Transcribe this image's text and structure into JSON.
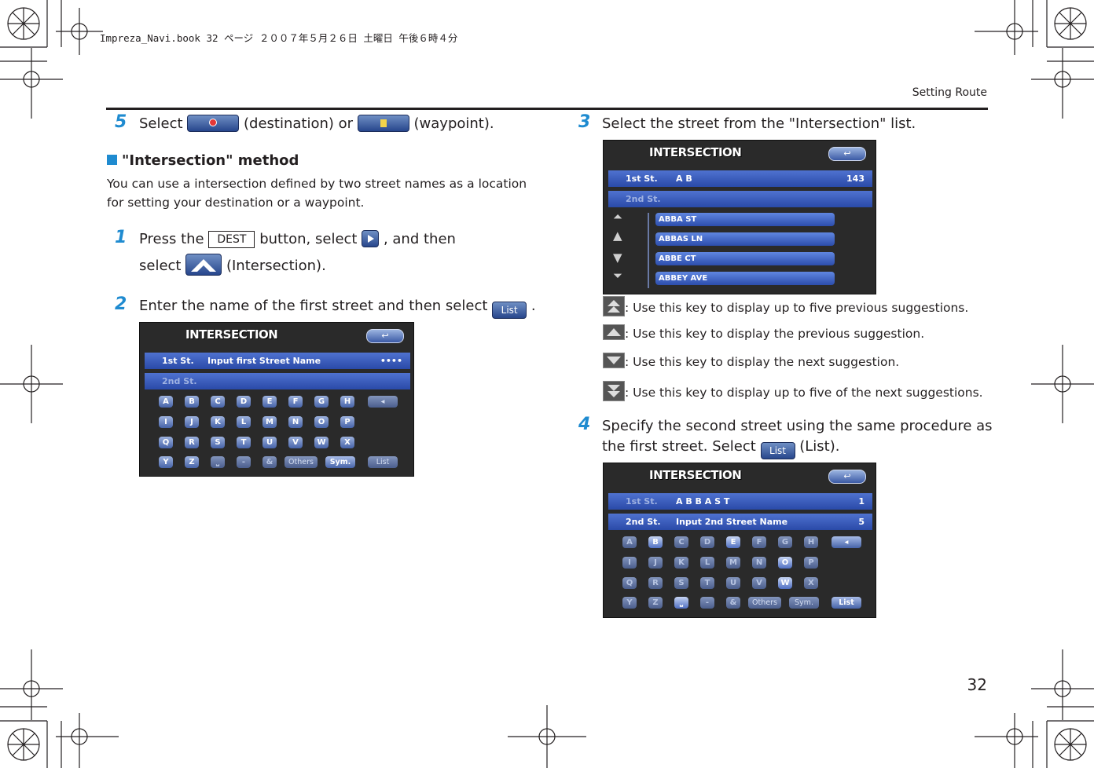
{
  "slug": "Impreza_Navi.book  32 ページ  ２００７年５月２６日  土曜日  午後６時４分",
  "running_head": "Setting Route",
  "page_number": "32",
  "left": {
    "step5": {
      "num": "5",
      "t1": "Select",
      "t2": "(destination) or",
      "t3": "(waypoint)."
    },
    "heading": "\"Intersection\" method",
    "intro": "You can use a intersection defined by two street names as a location for setting your destination or a waypoint.",
    "step1": {
      "num": "1",
      "t1": "Press the",
      "dest": "DEST",
      "t2": "button, select",
      "t3": ", and then",
      "t4": "select",
      "t5": "(Intersection)."
    },
    "step2": {
      "num": "2",
      "t1": "Enter the name of the first street and then select",
      "list": "List",
      "t2": "."
    }
  },
  "right": {
    "step3": {
      "num": "3",
      "t1": "Select the street from the \"Intersection\" list."
    },
    "notes": [
      ": Use this key to display up to five previous suggestions.",
      ": Use this key to display the previous suggestion.",
      ": Use this key to display the next suggestion.",
      ": Use this key to display up to five of the next suggestions."
    ],
    "step4": {
      "num": "4",
      "t1": "Specify the second street using the same procedure as",
      "t2": "the first street. Select",
      "list": "List",
      "t3": "(List)."
    }
  },
  "screen1": {
    "title": "INTERSECTION",
    "back": "↩",
    "row1_label": "1st St.",
    "row1_text": "Input first Street Name",
    "row1_right": "••••",
    "row2_label": "2nd St.",
    "keys_r1": [
      "A",
      "B",
      "C",
      "D",
      "E",
      "F",
      "G",
      "H"
    ],
    "keys_r2": [
      "I",
      "J",
      "K",
      "L",
      "M",
      "N",
      "O",
      "P"
    ],
    "keys_r3": [
      "Q",
      "R",
      "S",
      "T",
      "U",
      "V",
      "W",
      "X"
    ],
    "keys_r4": [
      "Y",
      "Z",
      "⎵",
      "-",
      "&"
    ],
    "others": "Others",
    "sym": "Sym.",
    "list": "List",
    "del": "◂"
  },
  "screen2": {
    "title": "INTERSECTION",
    "back": "↩",
    "row1_label": "1st St.",
    "row1_text": "A B",
    "row1_right": "143",
    "row2_label": "2nd St.",
    "items": [
      "ABBA ST",
      "ABBAS LN",
      "ABBE CT",
      "ABBEY AVE"
    ]
  },
  "screen3": {
    "title": "INTERSECTION",
    "back": "↩",
    "row1_label": "1st St.",
    "row1_text": "A B B A   S T",
    "row1_right": "1",
    "row2_label": "2nd St.",
    "row2_text": "Input 2nd Street Name",
    "row2_right": "5",
    "keys_r1": [
      "A",
      "B",
      "C",
      "D",
      "E",
      "F",
      "G",
      "H"
    ],
    "keys_r2": [
      "I",
      "J",
      "K",
      "L",
      "M",
      "N",
      "O",
      "P"
    ],
    "keys_r3": [
      "Q",
      "R",
      "S",
      "T",
      "U",
      "V",
      "W",
      "X"
    ],
    "keys_r4": [
      "Y",
      "Z",
      "⎵",
      "-",
      "&"
    ],
    "others": "Others",
    "sym": "Sym.",
    "list": "List",
    "del": "◂"
  }
}
